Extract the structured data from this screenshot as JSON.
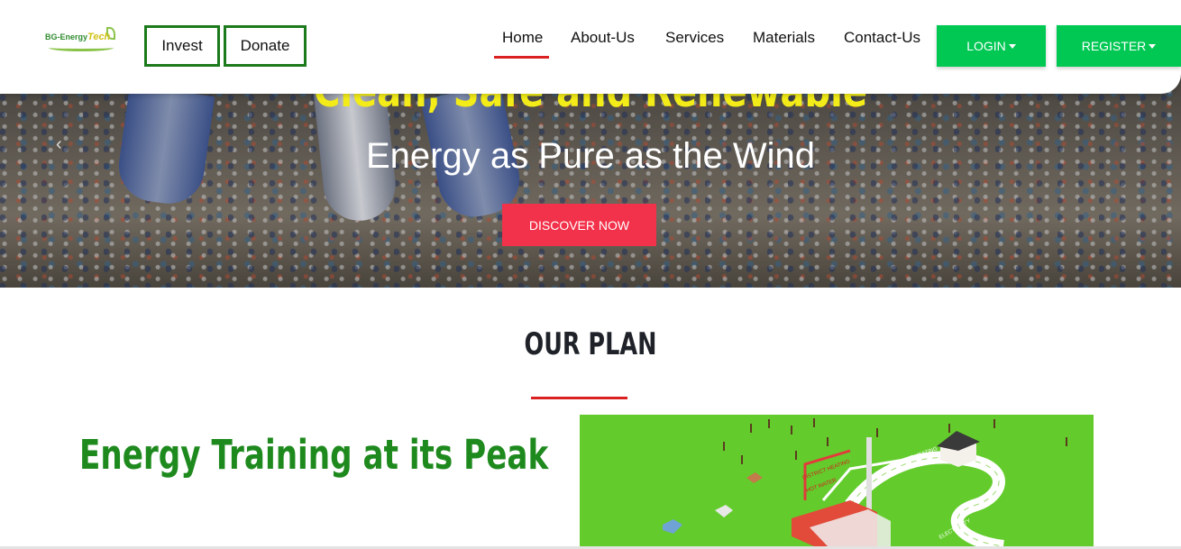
{
  "header": {
    "logo_text": "BG-Energy",
    "logo_text_sub": "Tech",
    "invest_label": "Invest",
    "donate_label": "Donate",
    "nav": [
      {
        "label": "Home",
        "active": true
      },
      {
        "label": "About-Us"
      },
      {
        "label": "Services"
      },
      {
        "label": "Materials"
      },
      {
        "label": "Contact-Us"
      }
    ],
    "login_label": "LOGIN",
    "register_label": "REGISTER"
  },
  "hero": {
    "heading": "Clean, Safe and Renewable",
    "subheading": "Energy as Pure as the Wind",
    "cta_label": "DISCOVER NOW",
    "prev_icon": "chevron-left-icon"
  },
  "plan": {
    "title": "OUR PLAN",
    "heading": "Energy Training at its Peak",
    "image_labels": {
      "label_1": "DISTRICT HEATING",
      "label_2": "HOT WATER",
      "label_3": "DISTRICT HEATING",
      "label_4": "ELECTRICITY"
    }
  },
  "colors": {
    "accent_green": "#00c853",
    "brand_green": "#1e8a1e",
    "accent_red": "#d92121",
    "cta_red": "#f2314a",
    "hero_yellow": "#f3ec18"
  }
}
